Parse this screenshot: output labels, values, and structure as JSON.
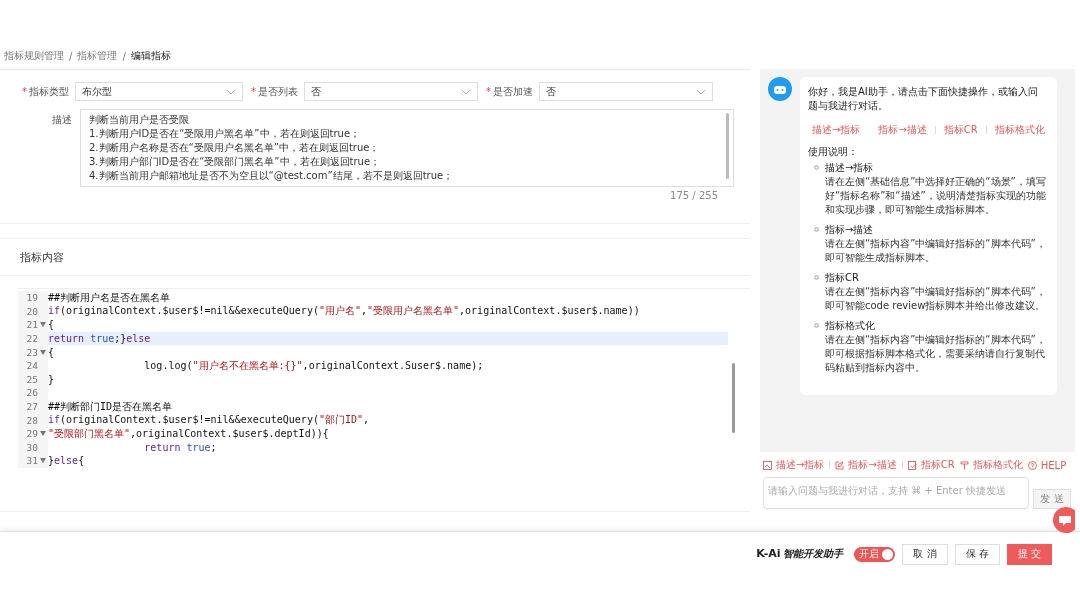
{
  "breadcrumb": [
    {
      "label": "指标规则管理",
      "current": false
    },
    {
      "separator": "/",
      "label": "指标管理",
      "current": false
    },
    {
      "separator": "/",
      "label": "编辑指标",
      "current": true
    }
  ],
  "form": {
    "selects": [
      {
        "required_mark": "*",
        "label": "指标类型",
        "value": "布尔型"
      },
      {
        "required_mark": "*",
        "label": "是否列表",
        "value": "否"
      },
      {
        "required_mark": "*",
        "label": "是否加速",
        "value": "否"
      }
    ],
    "description": {
      "label": "描述",
      "lines": [
        "判断当前用户是否受限",
        "1.判断用户ID是否在“受限用户黑名单”中，若在则返回true；",
        "2.判断用户名称是否在“受限用户名黑名单”中，若在则返回true；",
        "3.判断用户部门ID是否在“受限部门黑名单”中，若在则返回true；",
        "4.判断当前用户邮箱地址是否不为空且以“@test.com”结尾，若不是则返回true；"
      ],
      "counter": "175 / 255"
    }
  },
  "content": {
    "title": "指标内容",
    "code": [
      {
        "number": "19",
        "foldable": false,
        "selected": false,
        "segments": [
          {
            "kind": "plain",
            "text": "##判断用户名是否在黑名单"
          }
        ]
      },
      {
        "number": "20",
        "foldable": false,
        "selected": false,
        "segments": [
          {
            "kind": "keyword",
            "text": "if"
          },
          {
            "kind": "plain",
            "text": "(originalContext.$user$!=nil&&executeQuery("
          },
          {
            "kind": "string",
            "text": "\"用户名\""
          },
          {
            "kind": "plain",
            "text": ","
          },
          {
            "kind": "string",
            "text": "\"受限用户名黑名单\""
          },
          {
            "kind": "plain",
            "text": ",originalContext.$user$.name))"
          }
        ]
      },
      {
        "number": "21",
        "foldable": true,
        "selected": false,
        "segments": [
          {
            "kind": "plain",
            "text": "{"
          }
        ]
      },
      {
        "number": "22",
        "foldable": false,
        "selected": true,
        "segments": [
          {
            "kind": "keyword",
            "text": "return"
          },
          {
            "kind": "literal",
            "text": " true"
          },
          {
            "kind": "plain",
            "text": ";}"
          },
          {
            "kind": "keyword",
            "text": "else"
          }
        ]
      },
      {
        "number": "23",
        "foldable": true,
        "selected": false,
        "segments": [
          {
            "kind": "plain",
            "text": "{"
          }
        ]
      },
      {
        "number": "24",
        "foldable": false,
        "selected": false,
        "segments": [
          {
            "kind": "plain",
            "text": "                log.log("
          },
          {
            "kind": "string",
            "text": "\"用户名不在黑名单:{}\""
          },
          {
            "kind": "plain",
            "text": ",originalContext.Suser$.name);"
          }
        ]
      },
      {
        "number": "25",
        "foldable": false,
        "selected": false,
        "segments": [
          {
            "kind": "plain",
            "text": "}"
          }
        ]
      },
      {
        "number": "26",
        "foldable": false,
        "selected": false
      },
      {
        "number": "27",
        "foldable": false,
        "selected": false,
        "segments": [
          {
            "kind": "plain",
            "text": "##判断部门ID是否在黑名单"
          }
        ]
      },
      {
        "number": "28",
        "foldable": false,
        "selected": false,
        "segments": [
          {
            "kind": "keyword",
            "text": "if"
          },
          {
            "kind": "plain",
            "text": "(originalContext.$user$!=nil&&executeQuery("
          },
          {
            "kind": "string",
            "text": "\"部门ID\""
          },
          {
            "kind": "plain",
            "text": ","
          }
        ]
      },
      {
        "number": "29",
        "foldable": true,
        "selected": false,
        "segments": [
          {
            "kind": "string",
            "text": "\"受限部门黑名单\""
          },
          {
            "kind": "plain",
            "text": ",originalContext.$user$.deptId)){"
          }
        ]
      },
      {
        "number": "30",
        "foldable": false,
        "selected": false,
        "segments": [
          {
            "kind": "keyword",
            "text": "                return"
          },
          {
            "kind": "literal",
            "text": " true"
          },
          {
            "kind": "plain",
            "text": ";"
          }
        ]
      },
      {
        "number": "31",
        "foldable": true,
        "selected": false,
        "segments": [
          {
            "kind": "plain",
            "text": "}"
          },
          {
            "kind": "keyword",
            "text": "else"
          },
          {
            "kind": "plain",
            "text": "{"
          }
        ]
      }
    ]
  },
  "assistant": {
    "greeting": "你好，我是AI助手，请点击下面快捷操作，或输入问题与我进行对话。",
    "quick_links": [
      "描述→指标",
      "指标→描述",
      "指标CR",
      "指标格式化"
    ],
    "usage_title": "使用说明：",
    "usage": [
      {
        "title": "描述→指标",
        "text": "请在左侧“基础信息”中选择好正确的“场景”，填写好“指标名称”和“描述”，说明清楚指标实现的功能和实现步骤，即可智能生成指标脚本。"
      },
      {
        "title": "指标→描述",
        "text": "请在左侧“指标内容”中编辑好指标的“脚本代码”，即可智能生成指标脚本。"
      },
      {
        "title": "指标CR",
        "text": "请在左侧“指标内容”中编辑好指标的“脚本代码”，即可智能code review指标脚本并给出修改建议。"
      },
      {
        "title": "指标格式化",
        "text": "请在左侧“指标内容”中编辑好指标的“脚本代码”，即可根据指标脚本格式化，需要采纳请自行复制代码粘贴到指标内容中。"
      }
    ],
    "toolbar": [
      {
        "kind": "picture",
        "label": "描述→指标"
      },
      {
        "kind": "edit",
        "label": "指标→描述"
      },
      {
        "kind": "check",
        "label": "指标CR"
      },
      {
        "kind": "brush",
        "label": "指标格式化"
      },
      {
        "kind": "help",
        "label": "HELP"
      }
    ],
    "input": {
      "placeholder": "请输入问题与我进行对话，支持 ⌘ + Enter 快捷发送"
    },
    "send": {
      "label": "发 送",
      "disabled": true
    }
  },
  "footer": {
    "logo": "K-Ai",
    "logo_caption": "智能开发助手",
    "toggle": {
      "label": "开启",
      "on": true
    },
    "buttons": [
      {
        "label": "取 消",
        "primary": false
      },
      {
        "label": "保 存",
        "primary": false
      },
      {
        "label": "提 交",
        "primary": true
      }
    ]
  }
}
